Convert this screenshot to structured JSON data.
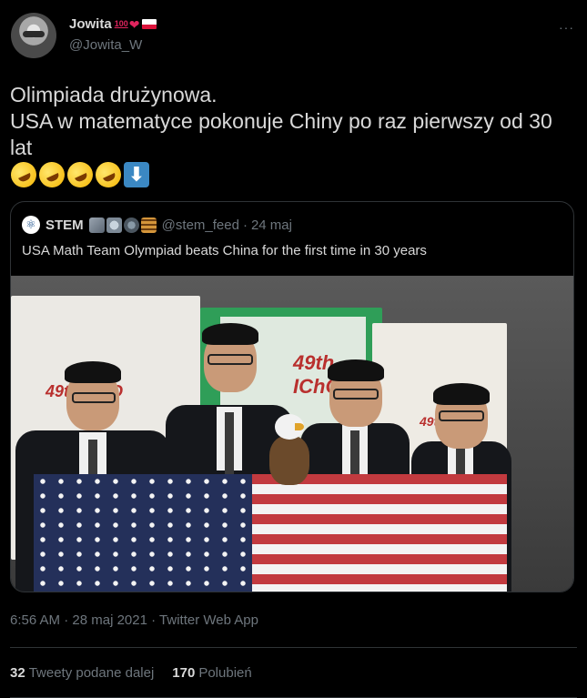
{
  "author": {
    "name": "Jowita",
    "badges": [
      "100-emoji",
      "red-heart-emoji",
      "poland-flag-emoji"
    ],
    "hundred_glyph": "100",
    "heart_glyph": "❤",
    "handle": "@Jowita_W"
  },
  "more_glyph": "···",
  "tweet": {
    "lines": [
      "Olimpiada drużynowa.",
      "USA w matematyce pokonuje Chiny po raz pierwszy od 30 lat"
    ],
    "emojis": [
      "rolling-on-floor-laughing",
      "rolling-on-floor-laughing",
      "rolling-on-floor-laughing",
      "rolling-on-floor-laughing",
      "down-arrow"
    ],
    "arrow_glyph": "⬇"
  },
  "quoted": {
    "name": "STEM",
    "avatar_glyph": "⚛",
    "name_emojis": [
      "microscope",
      "robot",
      "gear",
      "abacus"
    ],
    "handle": "@stem_feed",
    "separator": "·",
    "date": "24 maj",
    "text": "USA Math Team Olympiad beats China for the first time in 30 years",
    "photo": {
      "banner_text_left": "49th IChO",
      "banner_text_mid": "49th IChO",
      "banner_text_right": "49th IChO"
    }
  },
  "meta": {
    "time": "6:56 AM",
    "separator": "·",
    "date": "28 maj 2021",
    "source": "Twitter Web App"
  },
  "stats": {
    "retweets_count": "32",
    "retweets_label": "Tweety podane dalej",
    "likes_count": "170",
    "likes_label": "Polubień"
  },
  "colors": {
    "background": "#000000",
    "text": "#d9d9d9",
    "secondary": "#6e767d",
    "border": "#2f3336",
    "heart": "#e0245e"
  }
}
